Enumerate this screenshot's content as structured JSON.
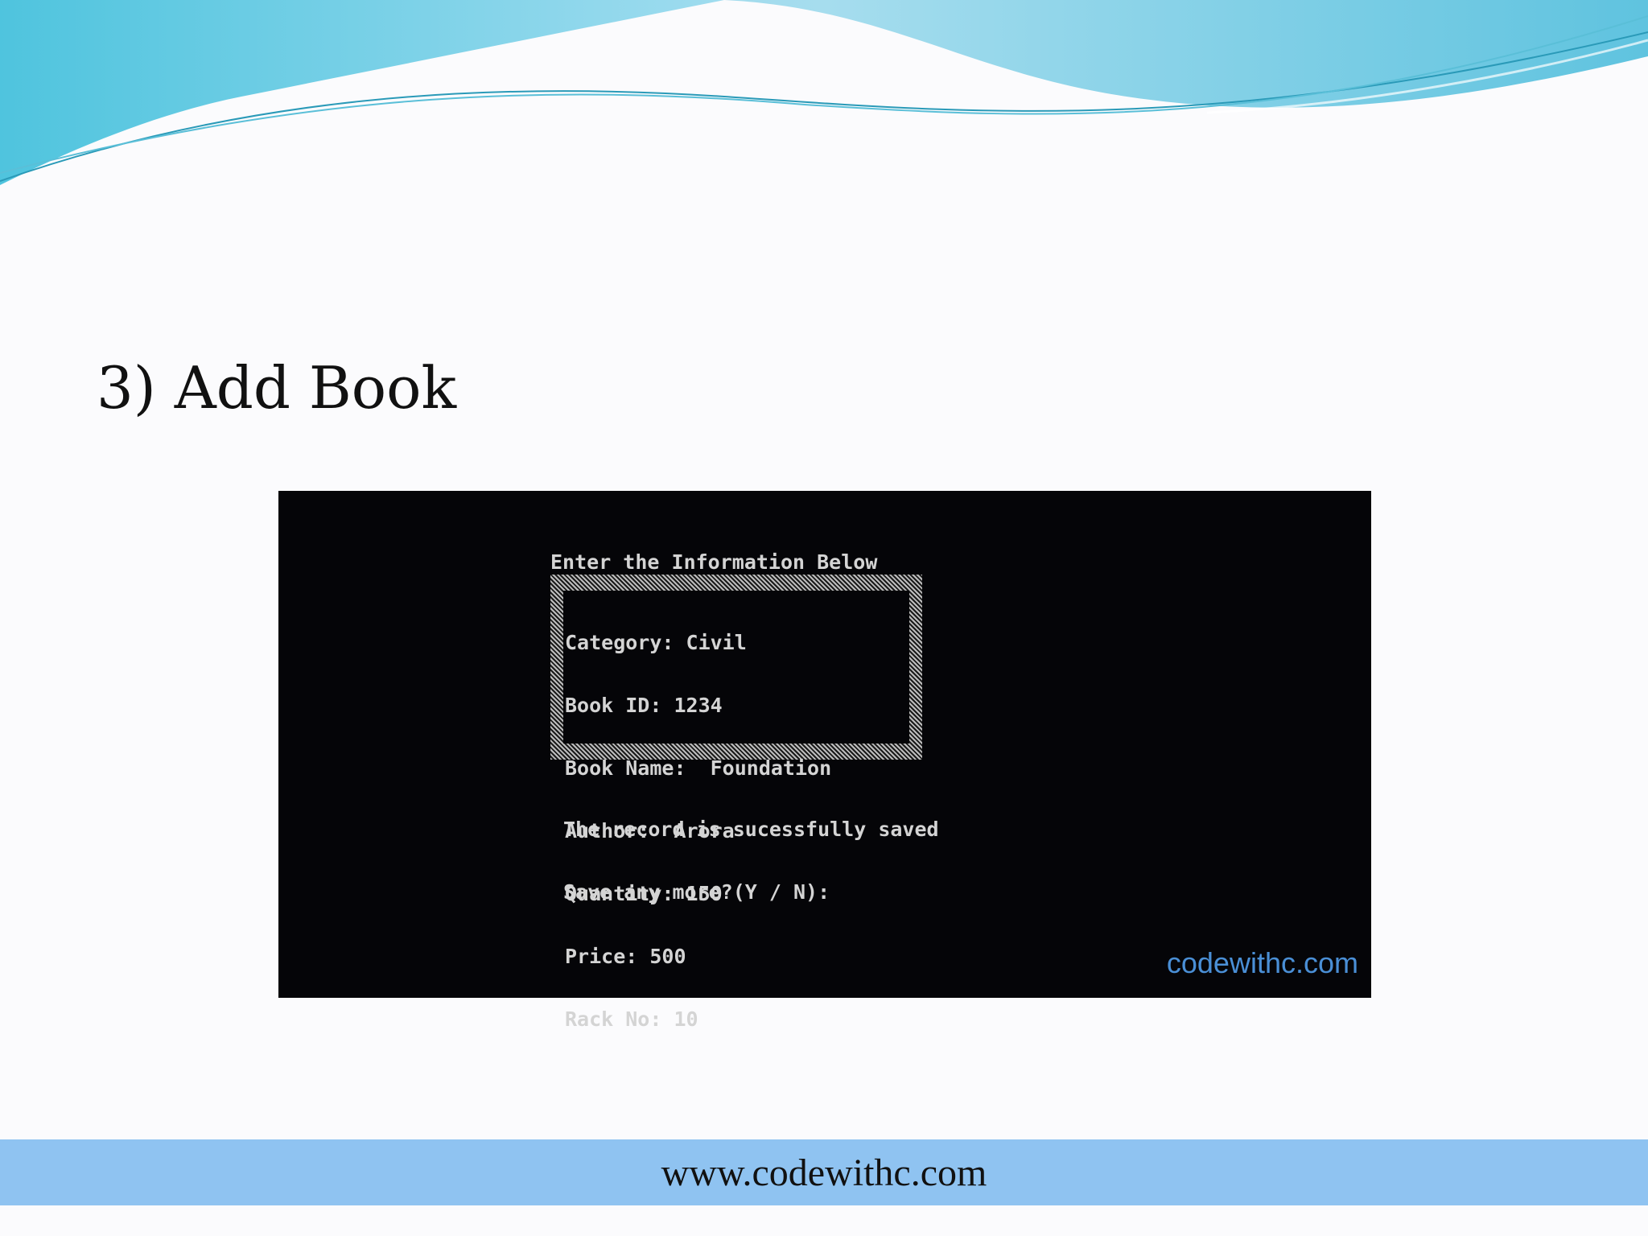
{
  "slide": {
    "title": "3) Add Book",
    "footer_url": "www.codewithc.com"
  },
  "console": {
    "heading": "Enter the Information Below",
    "fields": [
      "Category: Civil",
      "Book ID: 1234",
      "Book Name:  Foundation",
      "Author:  Arora",
      "Quantity: 150",
      "Price: 500",
      "Rack No: 10"
    ],
    "messages": [
      "The record is sucessfully saved",
      "Save any more?(Y / N):"
    ],
    "watermark": "codewithc.com"
  },
  "colors": {
    "wave_light": "#a8dcf0",
    "wave_mid": "#5fc7e0",
    "footer_bar": "#8fc3f1",
    "console_bg": "#050508",
    "console_text": "#d4d4d4",
    "watermark": "#4a8fd6"
  }
}
